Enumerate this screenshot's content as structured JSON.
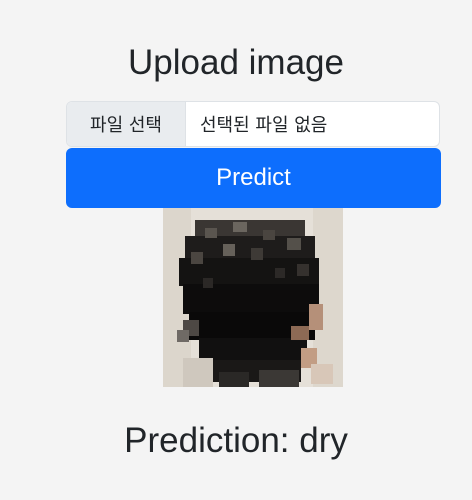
{
  "page": {
    "title": "Upload image",
    "file_button_label": "파일 선택",
    "file_status": "선택된 파일 없음",
    "predict_label": "Predict",
    "prediction_text": "Prediction: dry"
  },
  "colors": {
    "background": "#f4f4f4",
    "primary": "#0d6efd"
  }
}
